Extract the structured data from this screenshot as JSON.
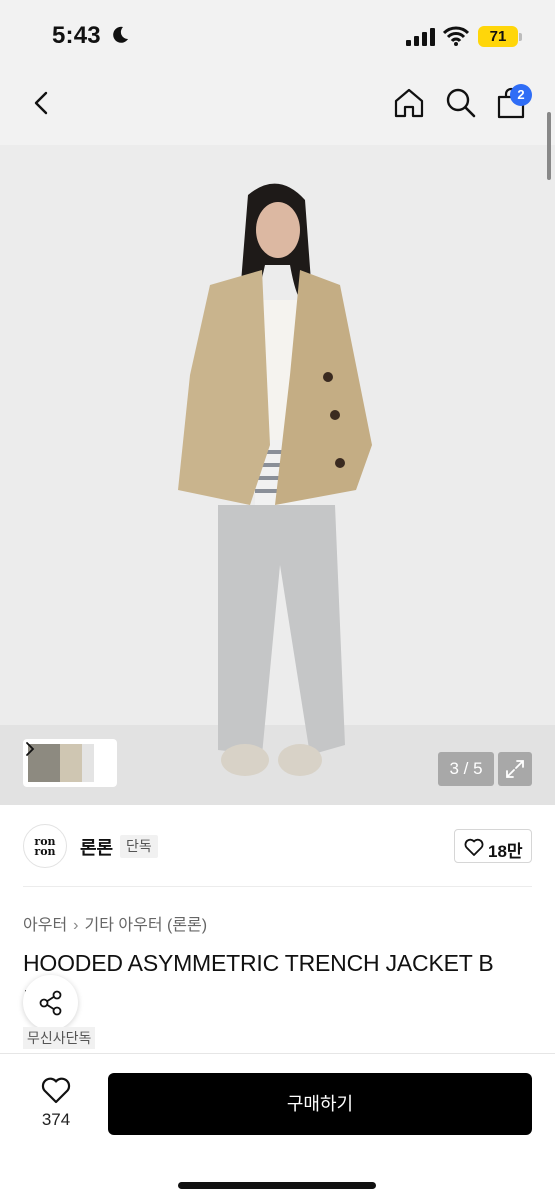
{
  "status": {
    "time": "5:43",
    "battery": "71"
  },
  "nav": {
    "cart_badge": "2"
  },
  "gallery": {
    "counter": "3 / 5"
  },
  "brand": {
    "logo_text": "ron ron",
    "name": "론론",
    "badge": "단독",
    "likes": "18만"
  },
  "breadcrumb": {
    "level1": "아우터",
    "separator": "›",
    "level2": "기타 아우터 (론론)"
  },
  "product": {
    "title": "HOODED ASYMMETRIC TRENCH JACKET B",
    "title_overflow": "I",
    "tag": "무신사단독"
  },
  "bottom": {
    "wishlist_count": "374",
    "buy_label": "구매하기"
  },
  "colors": {
    "accent": "#2f6df6",
    "battery": "#ffd60a",
    "buy": "#000000"
  },
  "icons": [
    "moon-icon",
    "signal-icon",
    "wifi-icon",
    "back-icon",
    "home-icon",
    "search-icon",
    "cart-icon",
    "chevron-right-icon",
    "expand-icon",
    "heart-icon",
    "share-icon"
  ]
}
